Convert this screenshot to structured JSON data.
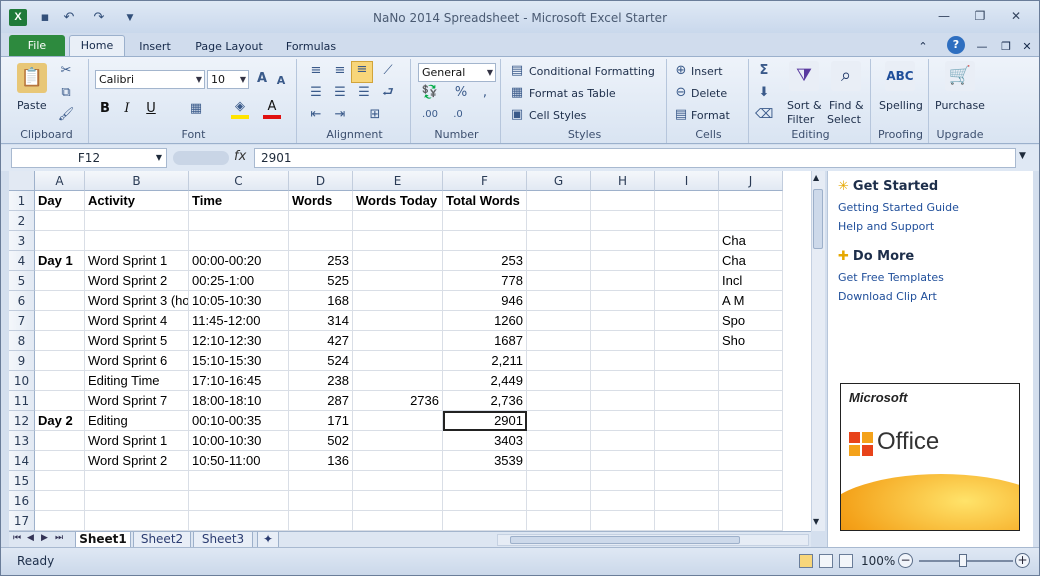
{
  "window": {
    "title": "NaNo 2014 Spreadsheet - Microsoft Excel Starter"
  },
  "tabs": [
    "File",
    "Home",
    "Insert",
    "Page Layout",
    "Formulas"
  ],
  "ribbon": {
    "clipboard": {
      "label": "Clipboard",
      "paste": "Paste"
    },
    "font": {
      "label": "Font",
      "name": "Calibri",
      "size": "10"
    },
    "alignment": {
      "label": "Alignment"
    },
    "number": {
      "label": "Number",
      "format": "General"
    },
    "styles": {
      "label": "Styles",
      "conditional": "Conditional Formatting",
      "table": "Format as Table",
      "cell_styles": "Cell Styles"
    },
    "cells": {
      "label": "Cells",
      "insert": "Insert",
      "delete": "Delete",
      "format": "Format"
    },
    "editing": {
      "label": "Editing",
      "sort": "Sort &",
      "filter": "Filter",
      "find": "Find &",
      "select": "Select"
    },
    "proofing": {
      "label": "Proofing",
      "spelling": "Spelling"
    },
    "upgrade": {
      "label": "Upgrade",
      "purchase": "Purchase"
    }
  },
  "formula_bar": {
    "name_box": "F12",
    "fx": "fx",
    "value": "2901"
  },
  "grid": {
    "columns": [
      "A",
      "B",
      "C",
      "D",
      "E",
      "F",
      "G",
      "H",
      "I",
      "J"
    ],
    "rows": [
      [
        "Day",
        "Activity",
        "Time",
        "Words",
        "Words Today",
        "Total Words",
        "",
        "",
        "",
        ""
      ],
      [
        "",
        "",
        "",
        "",
        "",
        "",
        "",
        "",
        "",
        ""
      ],
      [
        "",
        "",
        "",
        "",
        "",
        "",
        "",
        "",
        "",
        "Cha"
      ],
      [
        "Day 1",
        "Word Sprint 1",
        "00:00-00:20",
        "253",
        "",
        "253",
        "",
        "",
        "",
        "Cha"
      ],
      [
        "",
        "Word Sprint 2",
        "00:25-1:00",
        "525",
        "",
        "778",
        "",
        "",
        "",
        "Incl"
      ],
      [
        "",
        "Word Sprint 3 (hos",
        "10:05-10:30",
        "168",
        "",
        "946",
        "",
        "",
        "",
        "A M"
      ],
      [
        "",
        "Word Sprint 4",
        "11:45-12:00",
        "314",
        "",
        "1260",
        "",
        "",
        "",
        "Spo"
      ],
      [
        "",
        "Word Sprint 5",
        "12:10-12:30",
        "427",
        "",
        "1687",
        "",
        "",
        "",
        "Sho"
      ],
      [
        "",
        "Word Sprint 6",
        "15:10-15:30",
        "524",
        "",
        "2,211",
        "",
        "",
        "",
        ""
      ],
      [
        "",
        "Editing Time",
        "17:10-16:45",
        "238",
        "",
        "2,449",
        "",
        "",
        "",
        ""
      ],
      [
        "",
        "Word Sprint 7",
        "18:00-18:10",
        "287",
        "2736",
        "2,736",
        "",
        "",
        "",
        ""
      ],
      [
        "Day 2",
        "Editing",
        "00:10-00:35",
        "171",
        "",
        "2901",
        "",
        "",
        "",
        ""
      ],
      [
        "",
        "Word Sprint 1",
        "10:00-10:30",
        "502",
        "",
        "3403",
        "",
        "",
        "",
        ""
      ],
      [
        "",
        "Word Sprint 2",
        "10:50-11:00",
        "136",
        "",
        "3539",
        "",
        "",
        "",
        ""
      ],
      [
        "",
        "",
        "",
        "",
        "",
        "",
        "",
        "",
        "",
        ""
      ],
      [
        "",
        "",
        "",
        "",
        "",
        "",
        "",
        "",
        "",
        ""
      ],
      [
        "",
        "",
        "",
        "",
        "",
        "",
        "",
        "",
        "",
        ""
      ]
    ]
  },
  "task_pane": {
    "get_started": "Get Started",
    "getting_started_guide": "Getting Started Guide",
    "help_support": "Help and Support",
    "do_more": "Do More",
    "free_templates": "Get Free Templates",
    "clip_art": "Download Clip Art",
    "logo_microsoft": "Microsoft",
    "logo_office": "Office"
  },
  "sheets": [
    "Sheet1",
    "Sheet2",
    "Sheet3"
  ],
  "status": {
    "ready": "Ready",
    "zoom": "100%"
  }
}
